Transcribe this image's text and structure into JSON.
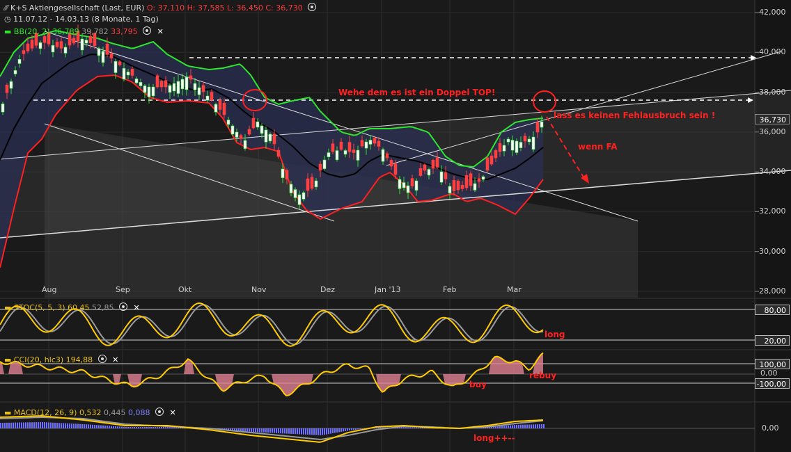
{
  "header": {
    "icon_chart": "chart-icon",
    "title": "K+S Aktiengesellschaft (Last, EUR)",
    "o_label": "O: 37,110",
    "h_label": "H: 37,585",
    "l_label": "L: 36,450",
    "c_label": "C: 36,730",
    "range": "11.07.12 - 14.03.13 (8 Monate, 1 Tag)",
    "bb_label": "BB(20, 2)",
    "bb_val1": "36,789",
    "bb_val2": "39,782",
    "bb_val3": "33,795"
  },
  "price_axis": [
    "42,000",
    "40,000",
    "38,000",
    "36,000",
    "34,000",
    "32,000",
    "30,000",
    "28,000"
  ],
  "price_badge": "36,730",
  "months": [
    "Aug",
    "Sep",
    "Okt",
    "Nov",
    "Dez",
    "Jan '13",
    "Feb",
    "Mar"
  ],
  "annotations": {
    "double_top": "Wehe dem es ist ein Doppel TOP!",
    "no_break": "lass es keinen Fehlausbruch sein !",
    "if_fa": "wenn FA",
    "long1": "long",
    "buy": "buy",
    "rebuy": "rebuy",
    "long2": "long++--"
  },
  "stoch": {
    "label": "STOC(5, 5, 3)",
    "val1": "60,45",
    "val2": "52,85",
    "level_hi": "80,00",
    "level_lo": "20,00"
  },
  "cci": {
    "label": "CCI(20, hlc3)",
    "val": "194,88",
    "level_hi": "100,00",
    "level_mid": "0,00",
    "level_lo": "-100,00"
  },
  "macd": {
    "label": "MACD(12, 26, 9)",
    "val1": "0,532",
    "val2": "0,445",
    "val3": "0,088",
    "level_zero": "0,00"
  },
  "colors": {
    "bb_upper": "#2ee52e",
    "bb_lower": "#ff2020",
    "bb_mid": "#000000",
    "osc": "#ffcc00",
    "osc_signal": "#9a9a9a",
    "macd_hist": "#7070ff",
    "annotation": "#ff2020"
  },
  "chart_data": {
    "type": "line",
    "title": "K+S Aktiengesellschaft (Last, EUR)",
    "x": [
      "2012-07-11",
      "2012-08-01",
      "2012-09-01",
      "2012-10-01",
      "2012-11-01",
      "2012-12-01",
      "2013-01-01",
      "2013-02-01",
      "2013-03-01",
      "2013-03-14"
    ],
    "ylim": [
      28,
      42
    ],
    "series": [
      {
        "name": "BB(20, 2)",
        "values": [
          37.5,
          40.8,
          40.6,
          38.6,
          37.3,
          34.4,
          36.1,
          34.8,
          36.5,
          36.8
        ]
      },
      {
        "name": "Close",
        "values": [
          36.9,
          40.0,
          38.5,
          37.8,
          35.0,
          32.8,
          35.3,
          33.6,
          35.5,
          36.73
        ]
      }
    ],
    "ohlc_last": {
      "open": 37.11,
      "high": 37.585,
      "low": 36.45,
      "close": 36.73
    }
  }
}
